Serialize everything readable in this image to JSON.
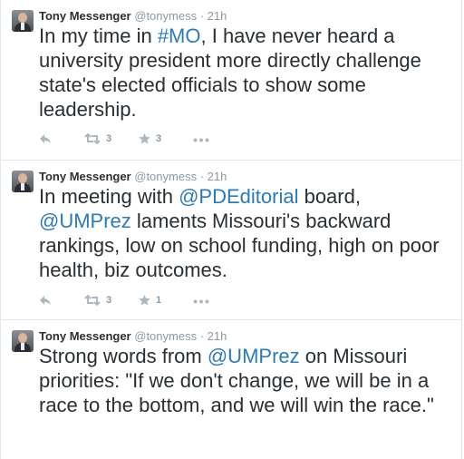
{
  "tweets": [
    {
      "author_name": "Tony Messenger",
      "handle": "@tonymess",
      "separator": "·",
      "time": "21h",
      "text_parts": [
        {
          "text": "In my time in ",
          "link": false
        },
        {
          "text": "#MO",
          "link": true
        },
        {
          "text": ", I have never heard a university president more directly challenge state's elected officials to show some leadership.",
          "link": false
        }
      ],
      "retweets": "3",
      "favorites": "3"
    },
    {
      "author_name": "Tony Messenger",
      "handle": "@tonymess",
      "separator": "·",
      "time": "21h",
      "text_parts": [
        {
          "text": "In meeting with ",
          "link": false
        },
        {
          "text": "@PDEditorial",
          "link": true
        },
        {
          "text": " board, ",
          "link": false
        },
        {
          "text": "@UMPrez",
          "link": true
        },
        {
          "text": " laments Missouri's backward rankings, low on school funding, high on poor health, biz outcomes.",
          "link": false
        }
      ],
      "retweets": "3",
      "favorites": "1"
    },
    {
      "author_name": "Tony Messenger",
      "handle": "@tonymess",
      "separator": "·",
      "time": "21h",
      "text_parts": [
        {
          "text": "Strong words from ",
          "link": false
        },
        {
          "text": "@UMPrez",
          "link": true
        },
        {
          "text": " on Missouri priorities: \"If we don't change, we will be in a race to the bottom, and we will win the race.\"",
          "link": false
        }
      ]
    }
  ],
  "icons": {
    "reply": "reply-arrow-icon",
    "retweet": "retweet-icon",
    "favorite": "star-icon",
    "more": "ellipsis-icon"
  },
  "colors": {
    "link": "#2b7bb9",
    "text": "#292f33",
    "meta": "#8899a6",
    "divider": "#e1e8ed"
  }
}
